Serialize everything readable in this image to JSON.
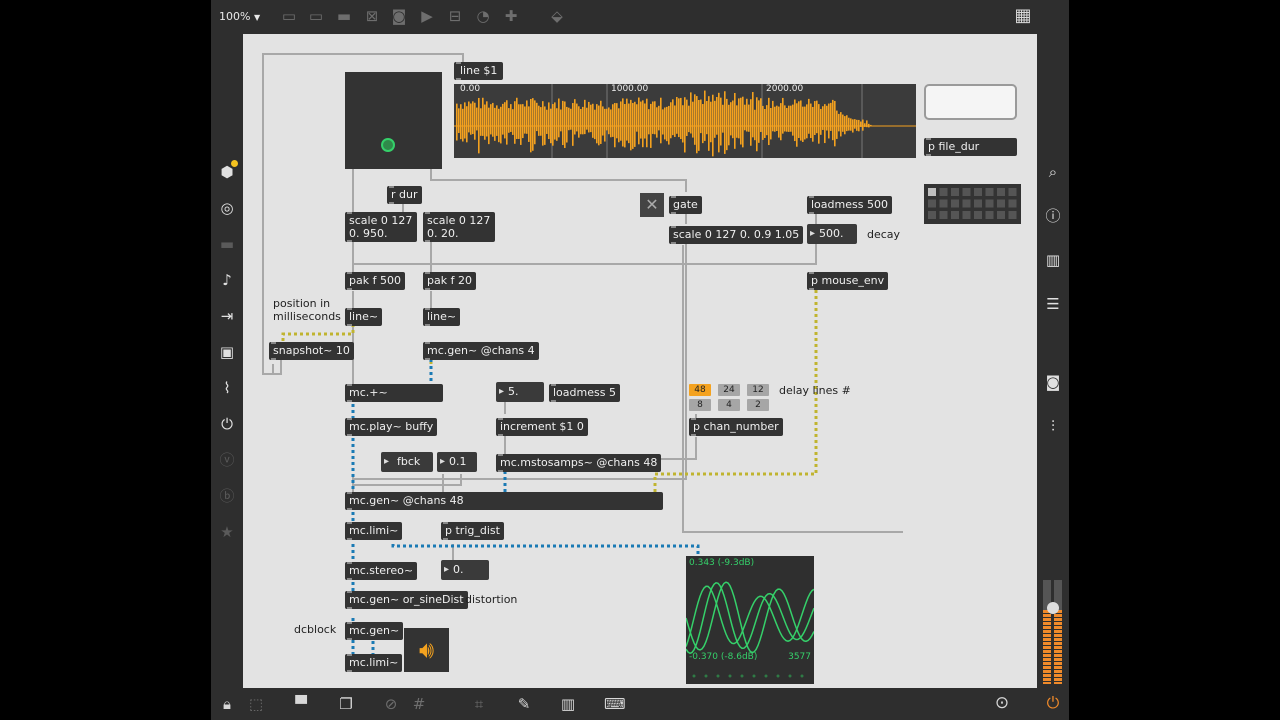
{
  "toolbar": {
    "zoom": "100%",
    "zoom_caret": "▼",
    "icons": [
      "presentation-icon",
      "message-box-icon",
      "comment-icon",
      "toggle-x-icon",
      "button-icon",
      "inlet-icon",
      "number-box-icon",
      "dial-icon",
      "add-object-icon",
      "paint-bucket-icon",
      "grid-list-icon"
    ]
  },
  "left_sidebar_icons": [
    "cube-icon",
    "record-icon",
    "display-icon",
    "music-note-icon",
    "play-sequence-icon",
    "image-icon",
    "paperclip-icon",
    "plug-icon",
    "v-badge-icon",
    "b-badge-icon",
    "star-icon"
  ],
  "right_sidebar_icons": [
    "search-icon",
    "info-icon",
    "book-icon",
    "list-icon",
    "camera-icon",
    "mixer-icon"
  ],
  "bottom_icons": [
    "lock-icon",
    "edit-icon",
    "presentation-icon",
    "windows-icon",
    "hide-icon",
    "grid-icon",
    "magnet-icon",
    "wrench-icon",
    "piano-icon",
    "keyboard-icon",
    "play-circle-icon",
    "power-icon"
  ],
  "patch": {
    "line_msg": "line $1",
    "waveform": {
      "t0": "0.00",
      "t1": "1000.00",
      "t2": "2000.00",
      "color": "#f4a21f"
    },
    "p_file_dur": "p file_dur",
    "r_dur": "r dur",
    "scale_a": [
      "scale 0 127",
      "0. 950."
    ],
    "scale_b": [
      "scale 0 127",
      "0. 20."
    ],
    "gate": "gate",
    "scale_c": "scale 0 127 0. 0.9 1.05",
    "loadmess_500": "loadmess 500",
    "num_500": "500.",
    "decay_label": "decay",
    "pak_500": "pak f 500",
    "pak_20": "pak f 20",
    "p_mouse_env": "p mouse_env",
    "position_label": [
      "position in",
      "milliseconds"
    ],
    "line_a": "line~",
    "line_b": "line~",
    "snapshot": "snapshot~ 10",
    "mc_gen_chans4": "mc.gen~ @chans 4",
    "mc_plus": "mc.+~",
    "num_5": "5.",
    "loadmess_5": "loadmess 5",
    "radio_values": [
      "48",
      "24",
      "12",
      "8",
      "4",
      "2"
    ],
    "radio_selected": "48",
    "delay_lines_label": "delay lines #",
    "mc_play": "mc.play~ buffy",
    "increment": "increment $1 0",
    "p_chan_number": "p chan_number",
    "fbck_label": "fbck",
    "num_01": "0.1",
    "mc_mstosamps": "mc.mstosamps~ @chans 48",
    "mc_gen_chans48": "mc.gen~ @chans 48",
    "mc_limi_a": "mc.limi~",
    "p_trig_dist": "p trig_dist",
    "mc_stereo": "mc.stereo~",
    "num_dist": "0.",
    "mc_gen_sinedist": "mc.gen~ or_sineDist",
    "distortion_label": "distortion",
    "dcblock_label": "dcblock",
    "mc_gen_dc": "mc.gen~",
    "mc_limi_b": "mc.limi~",
    "scope": {
      "top": "0.343 (-9.3dB)",
      "bottom": "-0.370 (-8.6dB)",
      "count": "3577",
      "color": "#35d06a"
    }
  }
}
